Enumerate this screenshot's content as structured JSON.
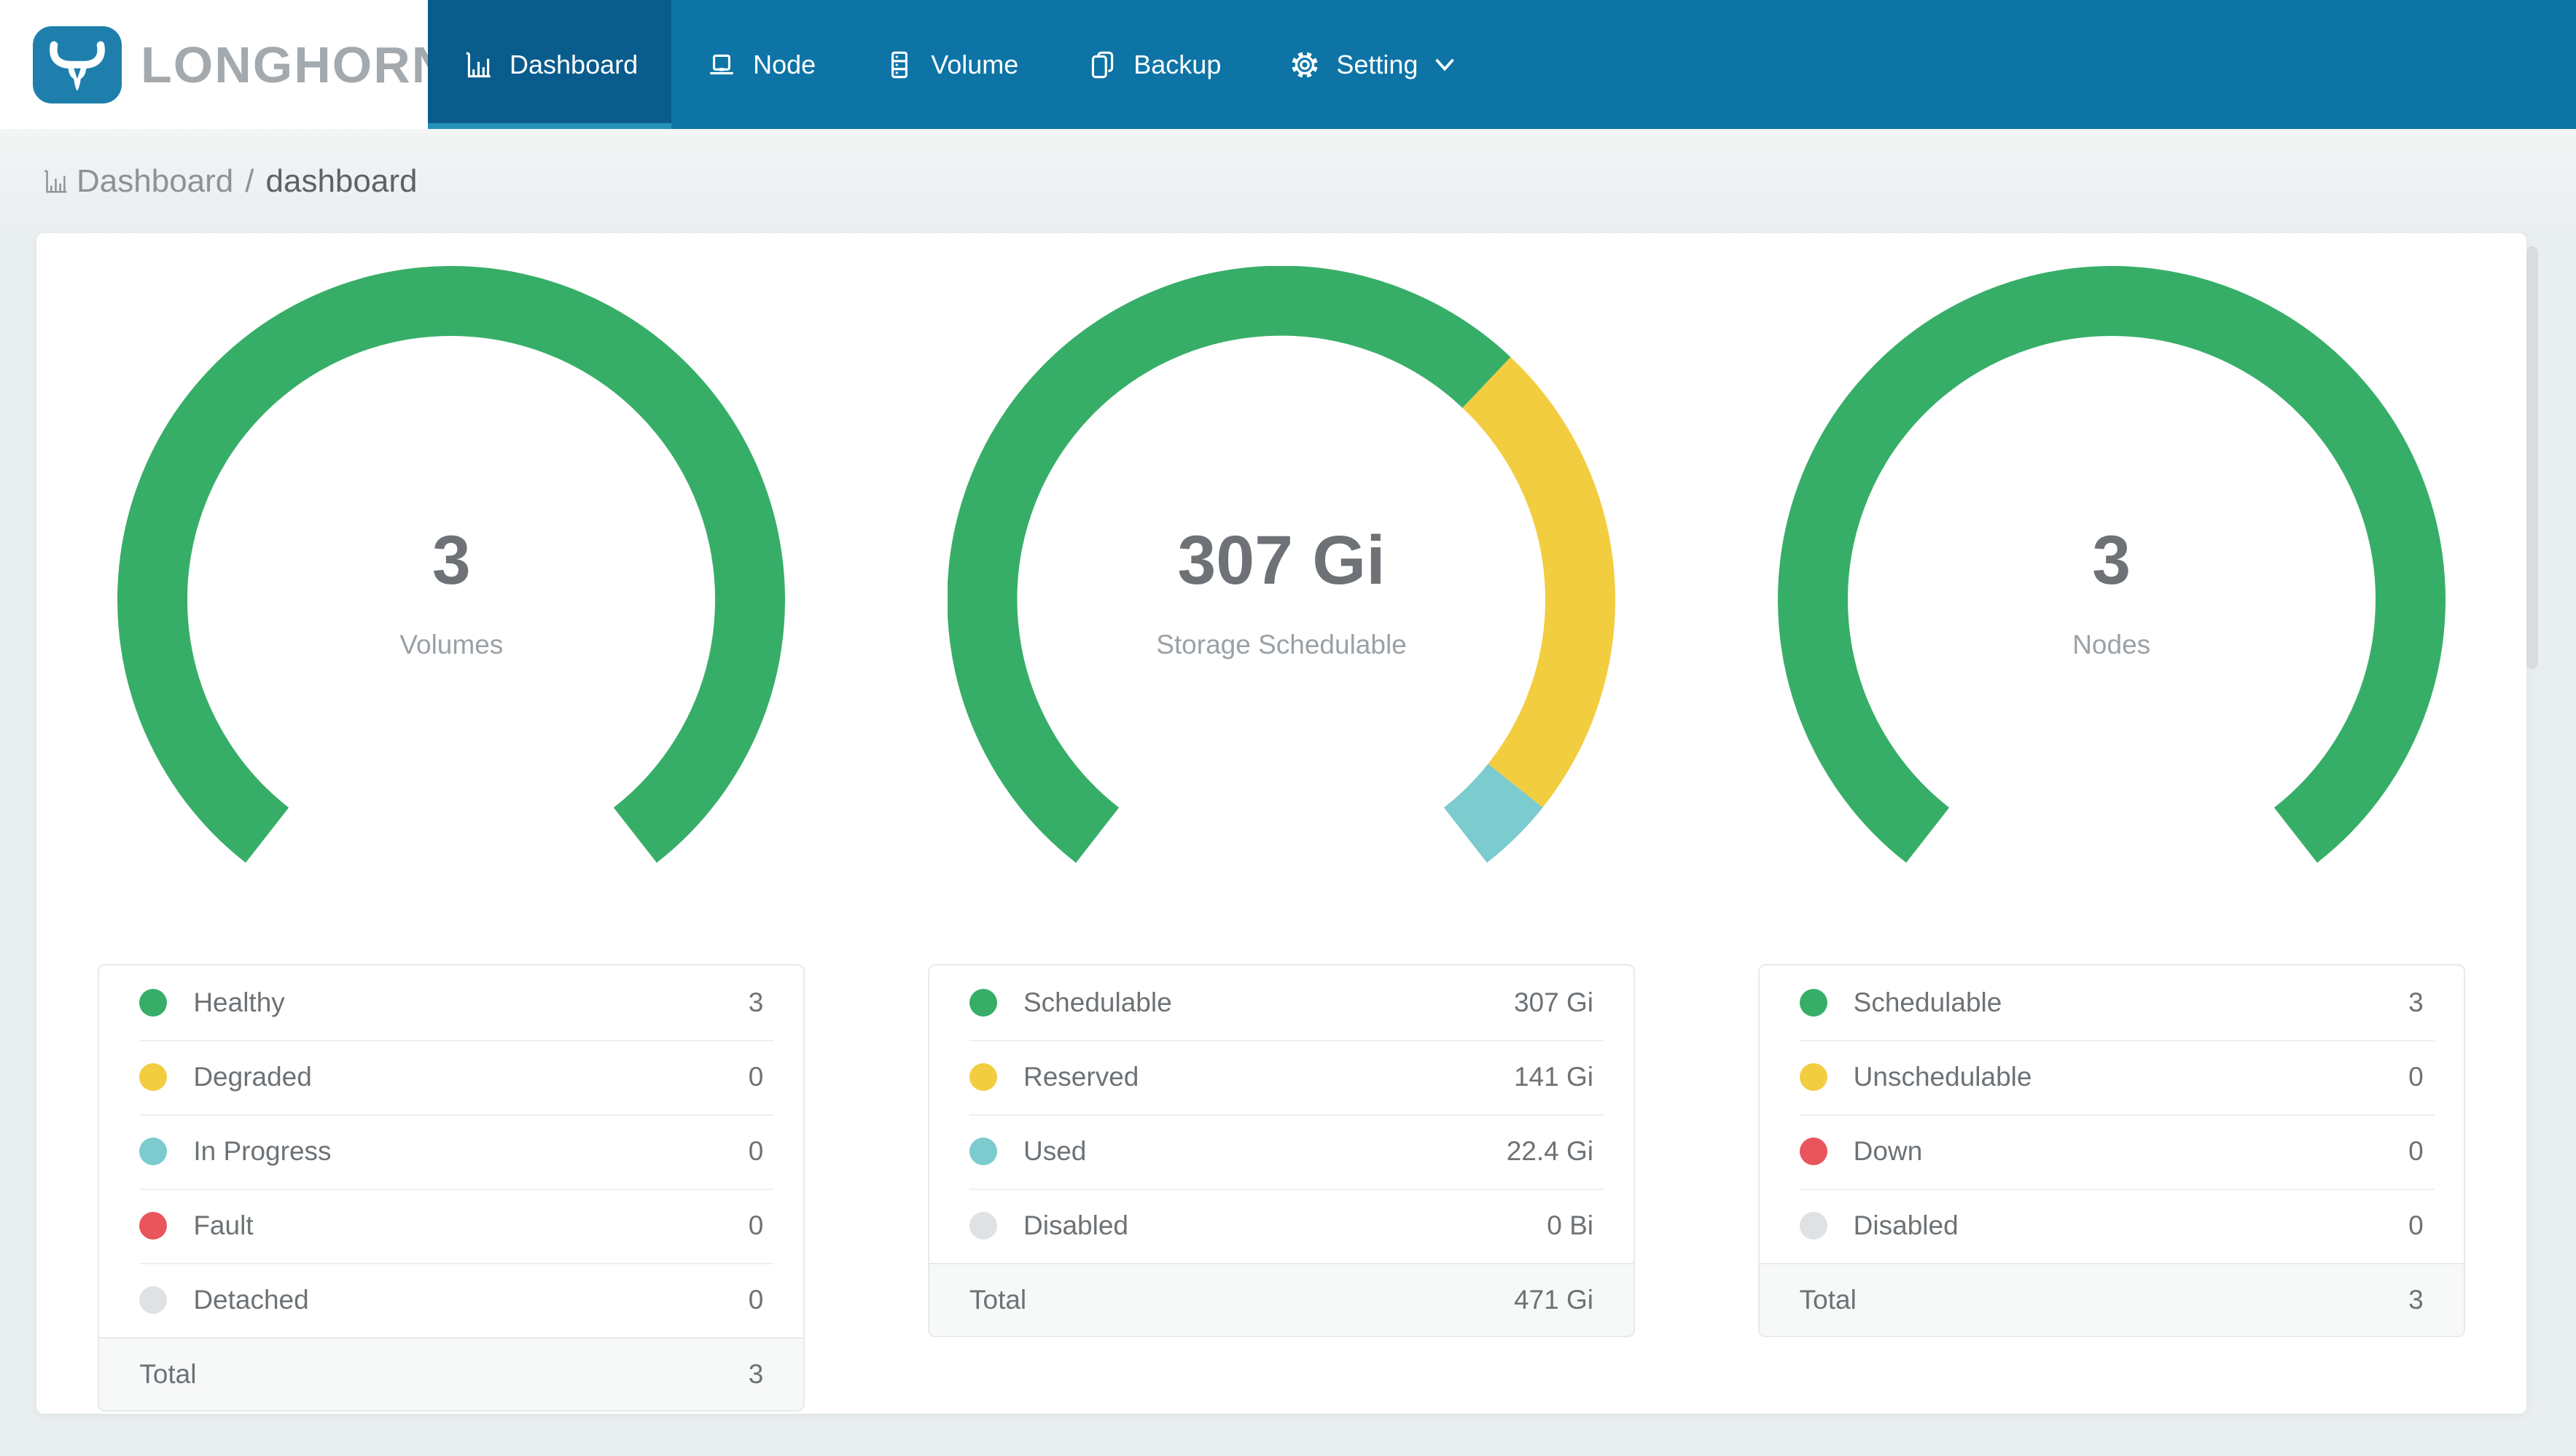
{
  "brand": {
    "name": "LONGHORN"
  },
  "nav": {
    "items": [
      {
        "label": "Dashboard",
        "icon": "dashboard-icon",
        "active": true
      },
      {
        "label": "Node",
        "icon": "node-icon",
        "active": false
      },
      {
        "label": "Volume",
        "icon": "volume-icon",
        "active": false
      },
      {
        "label": "Backup",
        "icon": "backup-icon",
        "active": false
      },
      {
        "label": "Setting",
        "icon": "gear-icon",
        "active": false,
        "has_caret": true
      }
    ]
  },
  "breadcrumb": {
    "root": "Dashboard",
    "separator": "/",
    "current": "dashboard"
  },
  "colors": {
    "page-bg": "#e9eeef",
    "nav-bg": "#0e74a5",
    "nav-active-bg": "#095c8c",
    "nav-underline": "#2492b8",
    "logo-blue": "#1e7fad",
    "brand-gray": "#a4a9ad",
    "text-gray": "#6d7276",
    "num-gray": "#6e7276",
    "sub-gray": "#9aa1a6",
    "crumb-root": "#8e9296",
    "crumb-current": "#5e6266",
    "status-green": "#37ae68",
    "status-yellow": "#f3cd40",
    "status-teal": "#7ccbce",
    "status-red": "#e9555d",
    "status-idle": "#dfe2e4"
  },
  "chart_data": [
    {
      "type": "gauge-donut",
      "title": "Volumes",
      "center_value": "3",
      "center_label": "Volumes",
      "arc_span_deg": 284,
      "arc_start_deg": 128,
      "segments": [
        {
          "label": "Healthy",
          "value": 3,
          "display": "3",
          "color": "#37ae68"
        },
        {
          "label": "Degraded",
          "value": 0,
          "display": "0",
          "color": "#f3cd40"
        },
        {
          "label": "In Progress",
          "value": 0,
          "display": "0",
          "color": "#7ccbce"
        },
        {
          "label": "Fault",
          "value": 0,
          "display": "0",
          "color": "#e9555d"
        },
        {
          "label": "Detached",
          "value": 0,
          "display": "0",
          "color": "#dfe2e4"
        }
      ],
      "total": {
        "label": "Total",
        "display": "3"
      }
    },
    {
      "type": "gauge-donut",
      "title": "Storage Schedulable",
      "center_value": "307 Gi",
      "center_label": "Storage Schedulable",
      "arc_span_deg": 284,
      "arc_start_deg": 128,
      "segments": [
        {
          "label": "Schedulable",
          "value": 307,
          "display": "307 Gi",
          "color": "#37ae68"
        },
        {
          "label": "Reserved",
          "value": 141,
          "display": "141 Gi",
          "color": "#f3cd40"
        },
        {
          "label": "Used",
          "value": 22.4,
          "display": "22.4 Gi",
          "color": "#7ccbce"
        },
        {
          "label": "Disabled",
          "value": 0,
          "display": "0 Bi",
          "color": "#dfe2e4"
        }
      ],
      "total": {
        "label": "Total",
        "display": "471 Gi"
      }
    },
    {
      "type": "gauge-donut",
      "title": "Nodes",
      "center_value": "3",
      "center_label": "Nodes",
      "arc_span_deg": 284,
      "arc_start_deg": 128,
      "segments": [
        {
          "label": "Schedulable",
          "value": 3,
          "display": "3",
          "color": "#37ae68"
        },
        {
          "label": "Unschedulable",
          "value": 0,
          "display": "0",
          "color": "#f3cd40"
        },
        {
          "label": "Down",
          "value": 0,
          "display": "0",
          "color": "#e9555d"
        },
        {
          "label": "Disabled",
          "value": 0,
          "display": "0",
          "color": "#dfe2e4"
        }
      ],
      "total": {
        "label": "Total",
        "display": "3"
      }
    }
  ]
}
